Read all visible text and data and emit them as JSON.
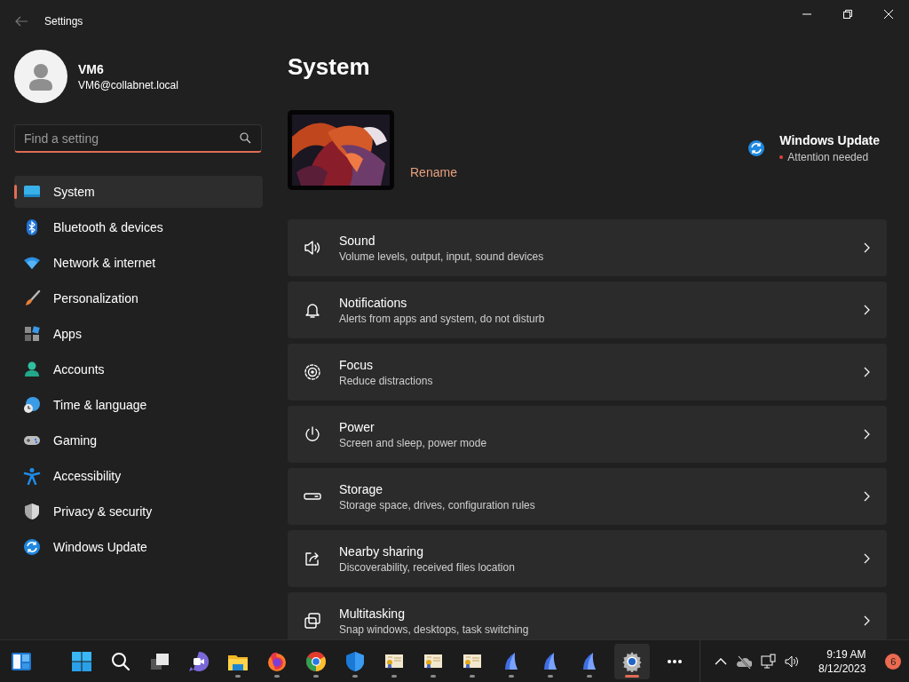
{
  "window": {
    "title": "Settings"
  },
  "account": {
    "name": "VM6",
    "email": "VM6@collabnet.local"
  },
  "search": {
    "placeholder": "Find a setting"
  },
  "sidebar": {
    "items": [
      {
        "kind": "system",
        "label": "System",
        "selected": true
      },
      {
        "kind": "bluetooth",
        "label": "Bluetooth & devices",
        "selected": false
      },
      {
        "kind": "network",
        "label": "Network & internet",
        "selected": false
      },
      {
        "kind": "personalization",
        "label": "Personalization",
        "selected": false
      },
      {
        "kind": "apps",
        "label": "Apps",
        "selected": false
      },
      {
        "kind": "accounts",
        "label": "Accounts",
        "selected": false
      },
      {
        "kind": "time",
        "label": "Time & language",
        "selected": false
      },
      {
        "kind": "gaming",
        "label": "Gaming",
        "selected": false
      },
      {
        "kind": "accessibility",
        "label": "Accessibility",
        "selected": false
      },
      {
        "kind": "privacy",
        "label": "Privacy & security",
        "selected": false
      },
      {
        "kind": "update",
        "label": "Windows Update",
        "selected": false
      }
    ]
  },
  "page": {
    "title": "System",
    "device": {
      "rename": "Rename"
    },
    "update": {
      "title": "Windows Update",
      "status": "Attention needed"
    },
    "cards": [
      {
        "kind": "sound",
        "title": "Sound",
        "subtitle": "Volume levels, output, input, sound devices"
      },
      {
        "kind": "notifications",
        "title": "Notifications",
        "subtitle": "Alerts from apps and system, do not disturb"
      },
      {
        "kind": "focus",
        "title": "Focus",
        "subtitle": "Reduce distractions"
      },
      {
        "kind": "power",
        "title": "Power",
        "subtitle": "Screen and sleep, power mode"
      },
      {
        "kind": "storage",
        "title": "Storage",
        "subtitle": "Storage space, drives, configuration rules"
      },
      {
        "kind": "sharing",
        "title": "Nearby sharing",
        "subtitle": "Discoverability, received files location"
      },
      {
        "kind": "multitasking",
        "title": "Multitasking",
        "subtitle": "Snap windows, desktops, task switching"
      }
    ]
  },
  "taskbar": {
    "apps": [
      {
        "kind": "widgets",
        "running": false,
        "selected": false
      },
      {
        "kind": "start",
        "running": false,
        "selected": false
      },
      {
        "kind": "search",
        "running": false,
        "selected": false
      },
      {
        "kind": "taskview",
        "running": false,
        "selected": false
      },
      {
        "kind": "chat",
        "running": false,
        "selected": false
      },
      {
        "kind": "explorer",
        "running": true,
        "selected": false
      },
      {
        "kind": "firefox",
        "running": true,
        "selected": false
      },
      {
        "kind": "chrome",
        "running": true,
        "selected": false
      },
      {
        "kind": "shield",
        "running": true,
        "selected": false
      },
      {
        "kind": "certificate",
        "running": true,
        "selected": false
      },
      {
        "kind": "certificate",
        "running": true,
        "selected": false
      },
      {
        "kind": "certificate",
        "running": true,
        "selected": false
      },
      {
        "kind": "fin",
        "running": true,
        "selected": false
      },
      {
        "kind": "fin",
        "running": true,
        "selected": false
      },
      {
        "kind": "fin",
        "running": true,
        "selected": false
      },
      {
        "kind": "settings",
        "running": true,
        "selected": true
      },
      {
        "kind": "more",
        "running": false,
        "selected": false
      }
    ],
    "tray": {
      "time": "9:19 AM",
      "date": "8/12/2023",
      "badge": "6"
    }
  }
}
